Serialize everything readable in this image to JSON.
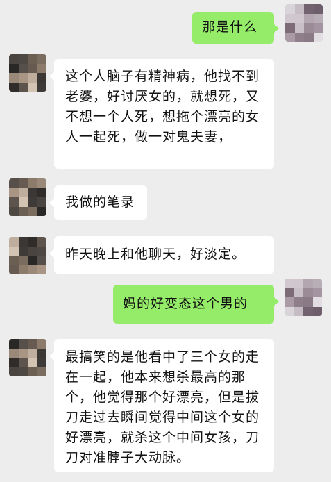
{
  "messages": [
    {
      "side": "right",
      "text": "那是什么"
    },
    {
      "side": "left",
      "text": "这个人脑子有精神病，他找不到老婆，好讨厌女的，就想死，又不想一个人死，想拖个漂亮的女人一起死，做一对鬼夫妻，"
    },
    {
      "side": "left",
      "text": "我做的笔录"
    },
    {
      "side": "left",
      "text": "昨天晚上和他聊天，好淡定。"
    },
    {
      "side": "right",
      "text": "妈的好变态这个男的"
    },
    {
      "side": "left",
      "text": "最搞笑的是他看中了三个女的走在一起，他本来想杀最高的那个，他觉得那个好漂亮，但是拔刀走过去瞬间觉得中间这个女的好漂亮，就杀这个中间女孩，刀刀对准脖子大动脉。"
    }
  ],
  "colors": {
    "background": "#ededed",
    "bubble_left": "#ffffff",
    "bubble_right": "#95ec69"
  }
}
